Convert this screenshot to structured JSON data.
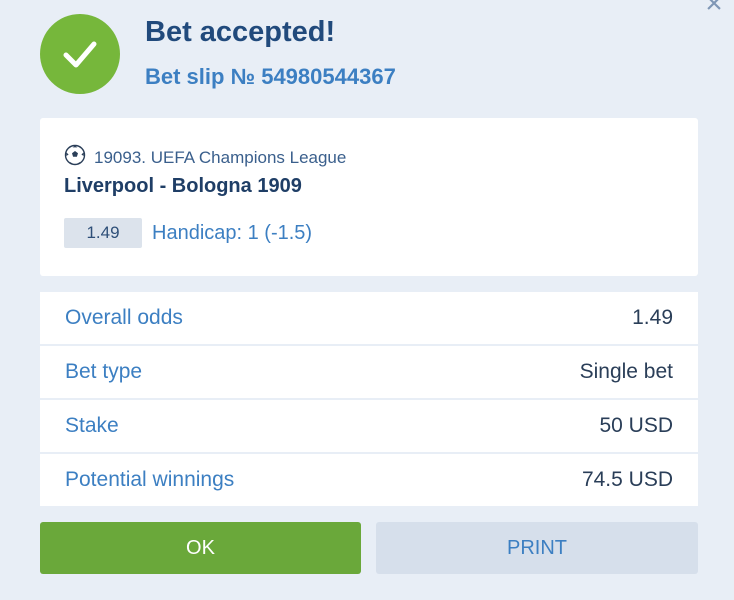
{
  "header": {
    "title": "Bet accepted!",
    "slip": "Bet slip № 54980544367",
    "close_icon": "close-icon"
  },
  "event": {
    "league": "19093. UEFA Champions League",
    "match": "Liverpool - Bologna 1909",
    "odds": "1.49",
    "market": "Handicap: 1 (-1.5)",
    "sport_icon": "football-icon"
  },
  "summary": [
    {
      "label": "Overall odds",
      "value": "1.49"
    },
    {
      "label": "Bet type",
      "value": "Single bet"
    },
    {
      "label": "Stake",
      "value": "50 USD"
    },
    {
      "label": "Potential winnings",
      "value": "74.5 USD"
    }
  ],
  "buttons": {
    "ok": "OK",
    "print": "PRINT"
  },
  "colors": {
    "accent_green": "#76b73b",
    "button_green": "#6aa83a",
    "link_blue": "#3c7fc2",
    "title_navy": "#214a7c"
  }
}
